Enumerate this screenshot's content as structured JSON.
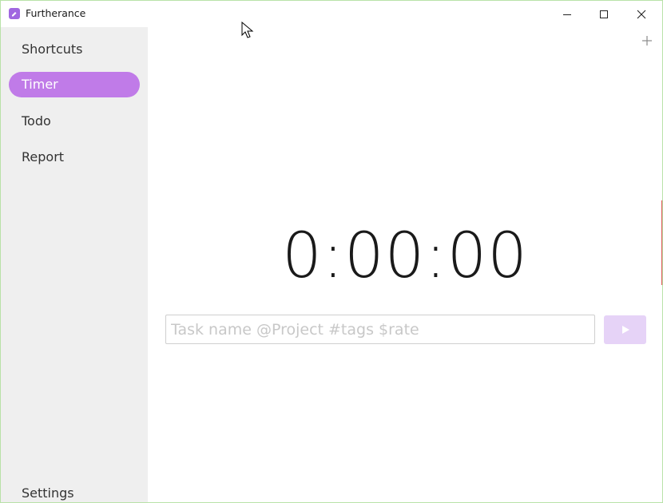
{
  "app": {
    "title": "Furtherance",
    "icon": "furtherance-app-icon",
    "accent_color": "#c07be8"
  },
  "window_controls": {
    "minimize_icon": "minimize-icon",
    "maximize_icon": "maximize-icon",
    "close_icon": "close-icon"
  },
  "sidebar": {
    "items": [
      {
        "label": "Shortcuts",
        "active": false
      },
      {
        "label": "Timer",
        "active": true
      },
      {
        "label": "Todo",
        "active": false
      },
      {
        "label": "Report",
        "active": false
      }
    ],
    "settings_label": "Settings"
  },
  "main": {
    "add_icon": "plus-icon",
    "timer_value": "0:00:00",
    "task_input": {
      "value": "",
      "placeholder": "Task name @Project #tags $rate"
    },
    "start_button_icon": "play-icon"
  }
}
